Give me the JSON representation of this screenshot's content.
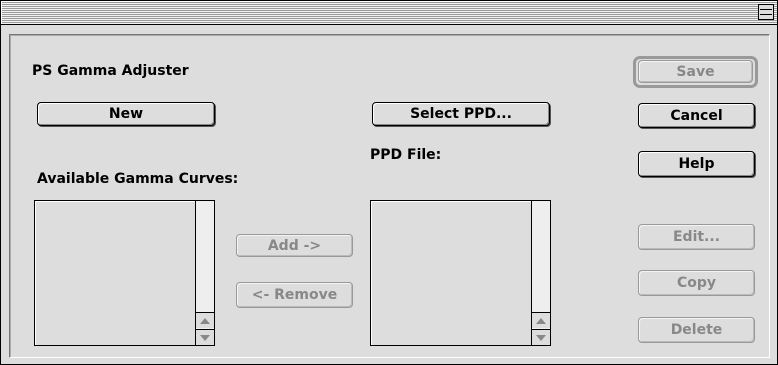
{
  "dialog": {
    "title": "PS Gamma Adjuster"
  },
  "labels": {
    "available_curves": "Available Gamma Curves:",
    "ppd_file": "PPD File:"
  },
  "buttons": {
    "new": "New",
    "select_ppd": "Select PPD...",
    "add": "Add ->",
    "remove": "<- Remove",
    "save": "Save",
    "cancel": "Cancel",
    "help": "Help",
    "edit": "Edit...",
    "copy": "Copy",
    "delete": "Delete"
  },
  "lists": {
    "available_curves_items": [],
    "ppd_file_items": []
  },
  "icons": {
    "zoom_box": "window-zoom-icon",
    "scroll_up": "up-arrow-icon",
    "scroll_down": "down-arrow-icon"
  },
  "states": {
    "save_enabled": false,
    "add_enabled": false,
    "remove_enabled": false,
    "edit_enabled": false,
    "copy_enabled": false,
    "delete_enabled": false
  }
}
